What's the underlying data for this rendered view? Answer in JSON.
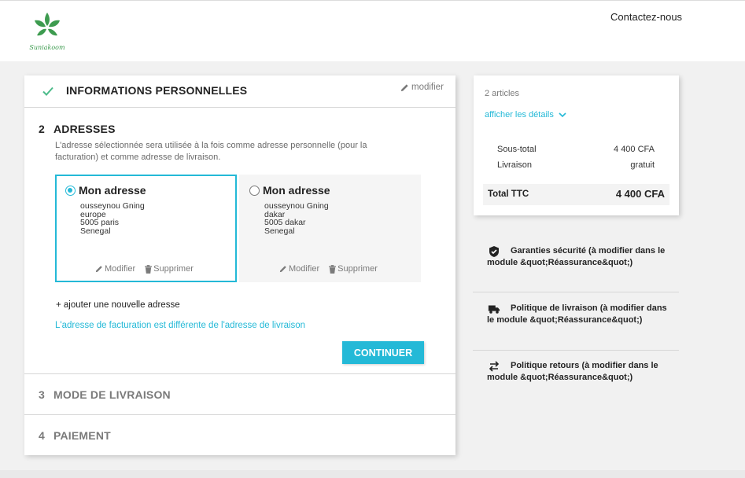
{
  "header": {
    "logo_text": "Suniakoom",
    "contact_label": "Contactez-nous"
  },
  "colors": {
    "accent": "#24b9d7",
    "brand_green": "#3d9b4f",
    "check_green": "#4cbb8a"
  },
  "steps": [
    {
      "label": "INFORMATIONS PERSONNELLES",
      "icon": "check-icon",
      "edit_label": "modifier"
    },
    {
      "number": "2",
      "label": "ADRESSES"
    },
    {
      "number": "3",
      "label": "MODE DE LIVRAISON"
    },
    {
      "number": "4",
      "label": "PAIEMENT"
    }
  ],
  "addresses": {
    "note": "L'adresse sélectionnée sera utilisée à la fois comme adresse personnelle (pour la facturation) et comme adresse de livraison.",
    "items": [
      {
        "title": "Mon adresse",
        "selected": true,
        "lines": [
          "ousseynou Gning",
          "europe",
          "5005 paris",
          "Senegal"
        ],
        "edit_label": "Modifier",
        "delete_label": "Supprimer"
      },
      {
        "title": "Mon adresse",
        "selected": false,
        "lines": [
          "ousseynou Gning",
          "dakar",
          "5005 dakar",
          "Senegal"
        ],
        "edit_label": "Modifier",
        "delete_label": "Supprimer"
      }
    ],
    "add_label": "+ ajouter une nouvelle adresse",
    "billing_link": "L'adresse de facturation est différente de l'adresse de livraison",
    "continue_label": "CONTINUER"
  },
  "summary": {
    "articles": "2 articles",
    "details_label": "afficher les détails",
    "subtotal_label": "Sous-total",
    "subtotal_value": "4 400 CFA",
    "shipping_label": "Livraison",
    "shipping_value": "gratuit",
    "total_label": "Total TTC",
    "total_value": "4 400 CFA"
  },
  "reassurance": [
    {
      "icon": "shield-icon",
      "text": "Garanties sécurité (à modifier dans le module &quot;Réassurance&quot;)"
    },
    {
      "icon": "truck-icon",
      "text": "Politique de livraison (à modifier dans le module &quot;Réassurance&quot;)"
    },
    {
      "icon": "swap-arrows-icon",
      "text": "Politique retours (à modifier dans le module &quot;Réassurance&quot;)"
    }
  ]
}
